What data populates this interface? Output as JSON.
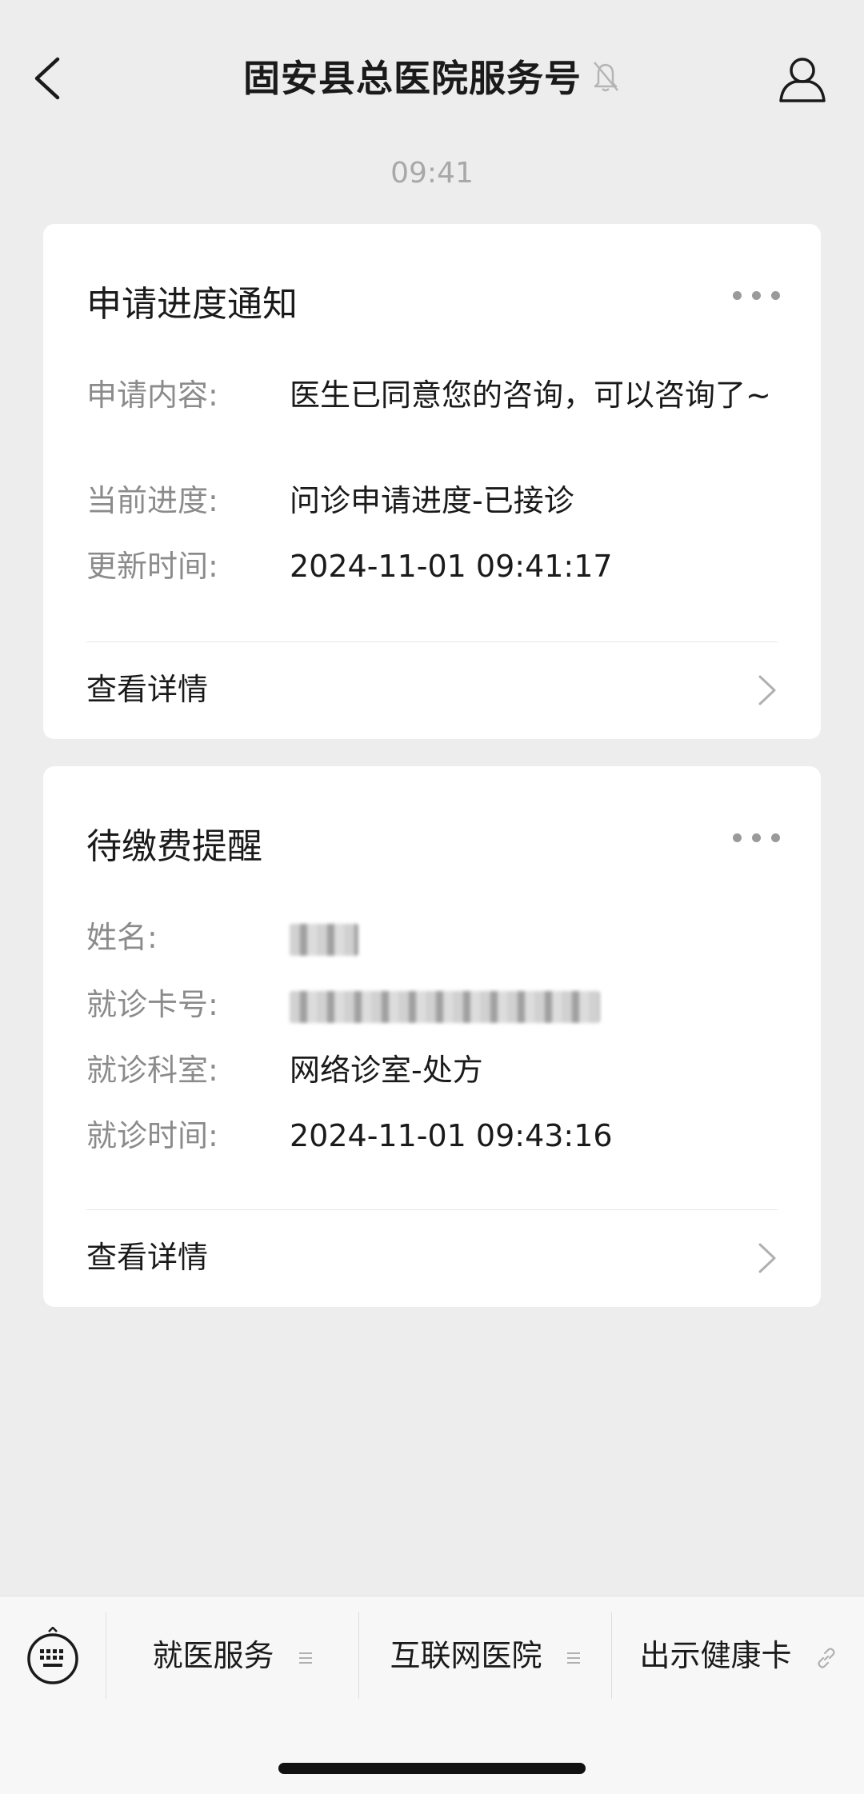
{
  "header": {
    "title": "固安县总医院服务号",
    "back_icon": "chevron-left-icon",
    "mute_icon": "bell-off-icon",
    "profile_icon": "person-icon"
  },
  "timestamp": "09:41",
  "cards": [
    {
      "title": "申请进度通知",
      "rows": [
        {
          "label": "申请内容:",
          "value": "医生已同意您的咨询，可以咨询了~"
        },
        {
          "label": "当前进度:",
          "value": "问诊申请进度-已接诊"
        },
        {
          "label": "更新时间:",
          "value": "2024-11-01 09:41:17"
        }
      ],
      "detail_label": "查看详情"
    },
    {
      "title": "待缴费提醒",
      "rows": [
        {
          "label": "姓名:",
          "value": ""
        },
        {
          "label": "就诊卡号:",
          "value": ""
        },
        {
          "label": "就诊科室:",
          "value": "网络诊室-处方"
        },
        {
          "label": "就诊时间:",
          "value": "2024-11-01 09:43:16"
        }
      ],
      "detail_label": "查看详情"
    }
  ],
  "bottom_menu": {
    "keyboard_icon": "keyboard-icon",
    "items": [
      {
        "label": "就医服务",
        "icon": "menu-lines-icon"
      },
      {
        "label": "互联网医院",
        "icon": "menu-lines-icon"
      },
      {
        "label": "出示健康卡",
        "icon": "link-icon"
      }
    ]
  },
  "colors": {
    "background": "#ededed",
    "card": "#ffffff",
    "label": "#8b8b8b",
    "text": "#1a1a1a",
    "timestamp": "#a8a8a8"
  }
}
